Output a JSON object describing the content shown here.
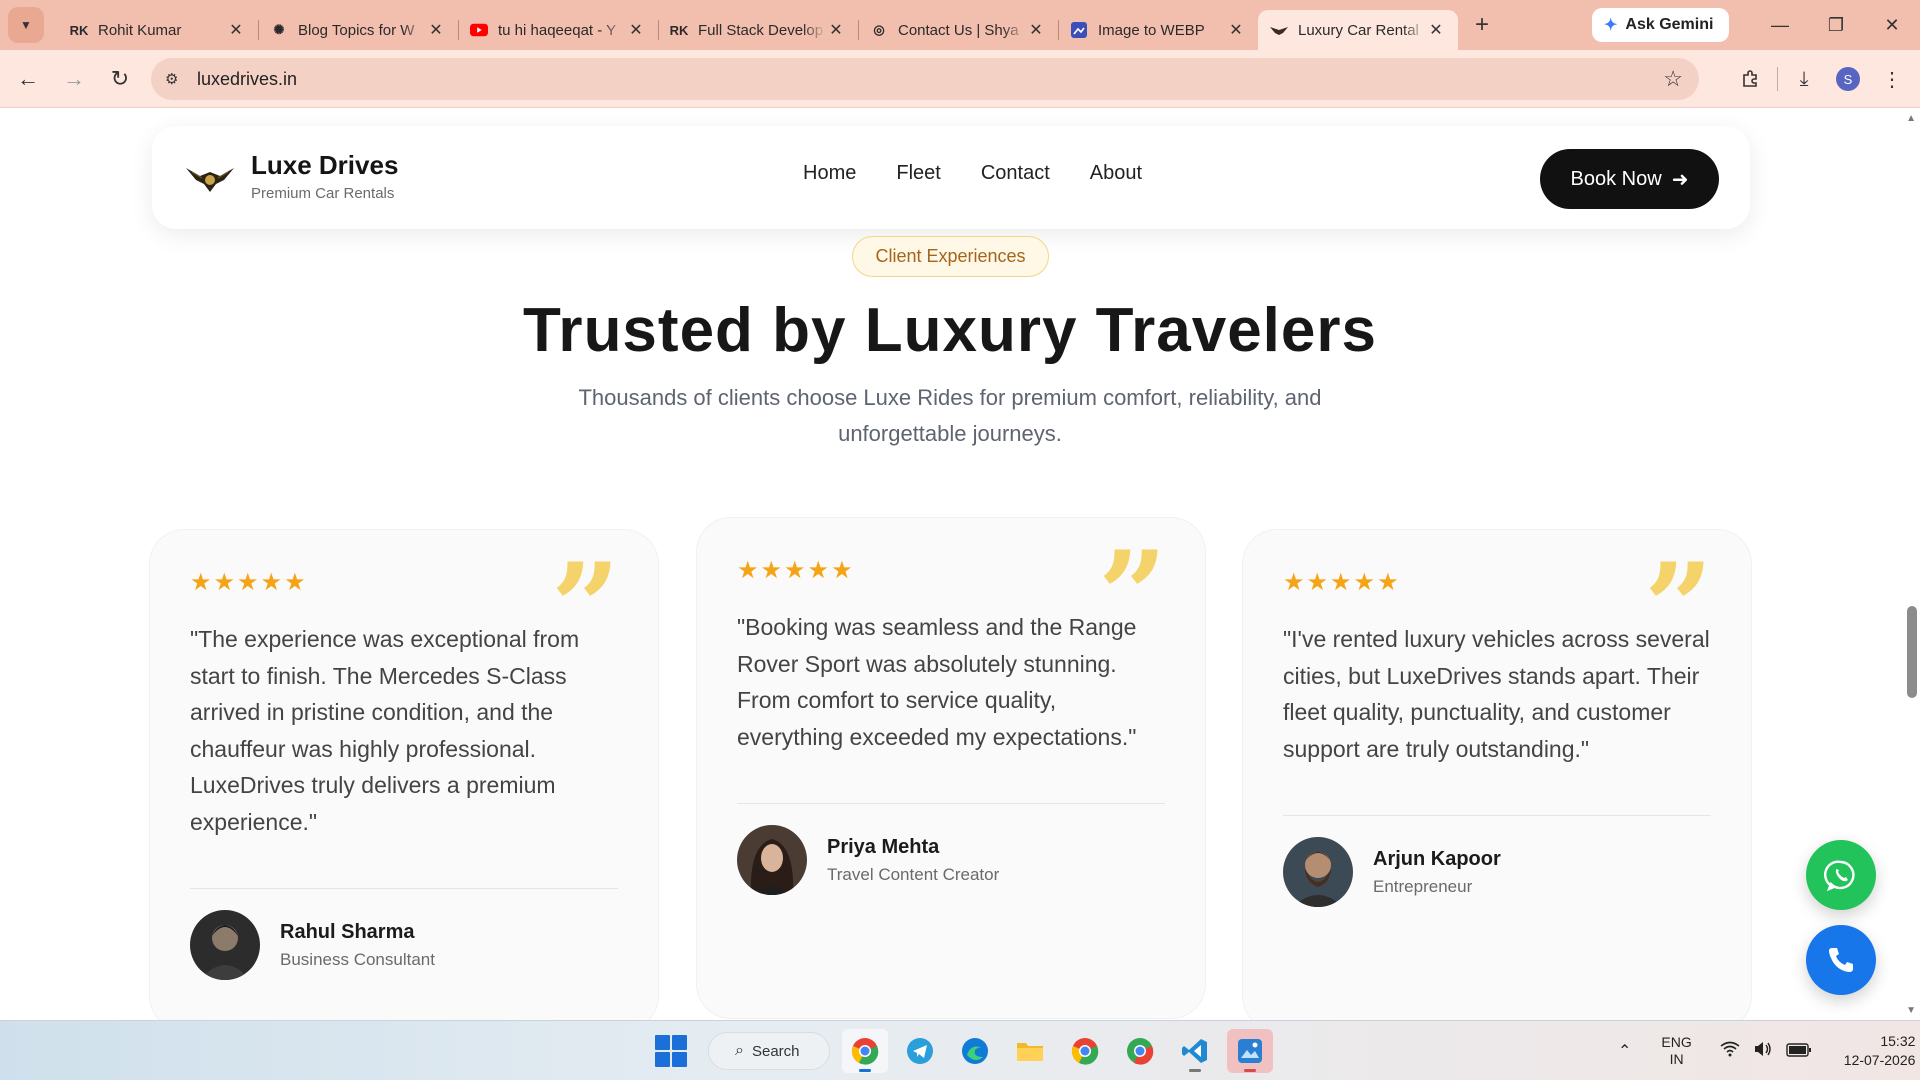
{
  "browser": {
    "tabs": [
      {
        "title": "Rohit Kumar",
        "icon": "rk-logo-icon",
        "active": false
      },
      {
        "title": "Blog Topics for W",
        "icon": "openai-icon",
        "active": false
      },
      {
        "title": "tu hi haqeeqat - Y",
        "icon": "youtube-icon",
        "active": false
      },
      {
        "title": "Full Stack Develop",
        "icon": "rk-logo-icon",
        "active": false
      },
      {
        "title": "Contact Us | Shya",
        "icon": "globe-icon",
        "active": false
      },
      {
        "title": "Image to WEBP",
        "icon": "image-convert-icon",
        "active": false
      },
      {
        "title": "Luxury Car Rental",
        "icon": "luxe-logo-icon",
        "active": true
      }
    ],
    "gemini_label": "Ask Gemini",
    "address": "luxedrives.in",
    "profile_initial": "S"
  },
  "site": {
    "brand_name": "Luxe Drives",
    "brand_tagline": "Premium Car Rentals",
    "nav": [
      "Home",
      "Fleet",
      "Contact",
      "About"
    ],
    "cta_label": "Book Now"
  },
  "section": {
    "badge": "Client Experiences",
    "title": "Trusted by Luxury Travelers",
    "subtitle": "Thousands of clients choose Luxe Rides for premium comfort, reliability, and unforgettable journeys."
  },
  "testimonials": [
    {
      "rating": 5,
      "quote": "\"The experience was exceptional from start to finish. The Mercedes S-Class arrived in pristine condition, and the chauffeur was highly professional. LuxeDrives truly delivers a premium experience.\"",
      "name": "Rahul Sharma",
      "role": "Business Consultant"
    },
    {
      "rating": 5,
      "quote": "\"Booking was seamless and the Range Rover Sport was absolutely stunning. From comfort to service quality, everything exceeded my expectations.\"",
      "name": "Priya Mehta",
      "role": "Travel Content Creator"
    },
    {
      "rating": 5,
      "quote": "\"I've rented luxury vehicles across several cities, but LuxeDrives stands apart. Their fleet quality, punctuality, and customer support are truly outstanding.\"",
      "name": "Arjun Kapoor",
      "role": "Entrepreneur"
    }
  ],
  "floating": {
    "whatsapp_icon": "whatsapp-icon",
    "phone_icon": "phone-icon"
  },
  "taskbar": {
    "search_label": "Search",
    "language_line1": "ENG",
    "language_line2": "IN",
    "time": "15:32",
    "date": "12-07-2026"
  },
  "colors": {
    "accent_star": "#f5a417",
    "quote_mark": "#f4d36b",
    "cta_bg": "#111111",
    "whatsapp": "#21c35a",
    "phone": "#1676ea",
    "tabbar": "#f2bfae"
  }
}
